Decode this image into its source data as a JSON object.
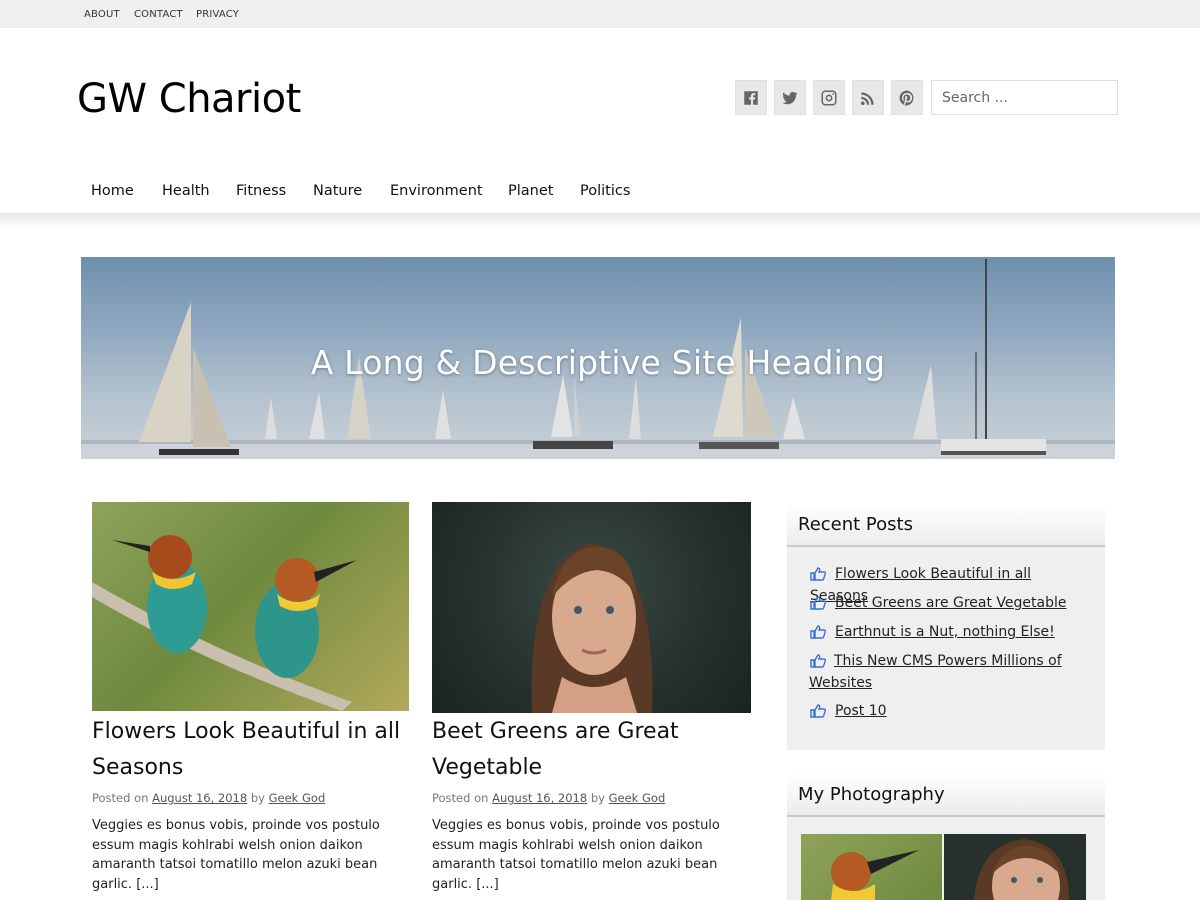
{
  "topbar": {
    "links": [
      "ABOUT",
      "CONTACT",
      "PRIVACY"
    ]
  },
  "header": {
    "site_title": "GW Chariot",
    "search_placeholder": "Search ...",
    "social_icons": [
      "facebook-icon",
      "twitter-icon",
      "instagram-icon",
      "rss-icon",
      "pinterest-icon"
    ]
  },
  "nav": {
    "items": [
      "Home",
      "Health",
      "Fitness",
      "Nature",
      "Environment",
      "Planet",
      "Politics"
    ]
  },
  "banner": {
    "heading": "A Long & Descriptive Site Heading"
  },
  "posts": [
    {
      "title": "Flowers Look Beautiful in all Seasons",
      "meta_prefix": "Posted on",
      "date": "August 16, 2018",
      "by": "by",
      "author": "Geek God",
      "excerpt": "Veggies es bonus vobis, proinde vos postulo essum magis kohlrabi welsh onion daikon amaranth tatsoi tomatillo melon azuki bean garlic. [...]"
    },
    {
      "title": "Beet Greens are Great Vegetable",
      "meta_prefix": "Posted on",
      "date": "August 16, 2018",
      "by": "by",
      "author": "Geek God",
      "excerpt": "Veggies es bonus vobis, proinde vos postulo essum magis kohlrabi welsh onion daikon amaranth tatsoi tomatillo melon azuki bean garlic. [...]"
    }
  ],
  "sidebar": {
    "recent_posts_title": "Recent Posts",
    "recent_posts": [
      "Flowers Look Beautiful in all Seasons",
      "Beet Greens are Great Vegetable",
      "Earthnut is a Nut, nothing Else!",
      "This New CMS Powers Millions of Websites",
      "Post 10"
    ],
    "photography_title": "My Photography"
  },
  "colors": {
    "topbar_bg": "#efefef",
    "widget_bg": "#efefef",
    "icon_blue": "#3b6fd8"
  }
}
